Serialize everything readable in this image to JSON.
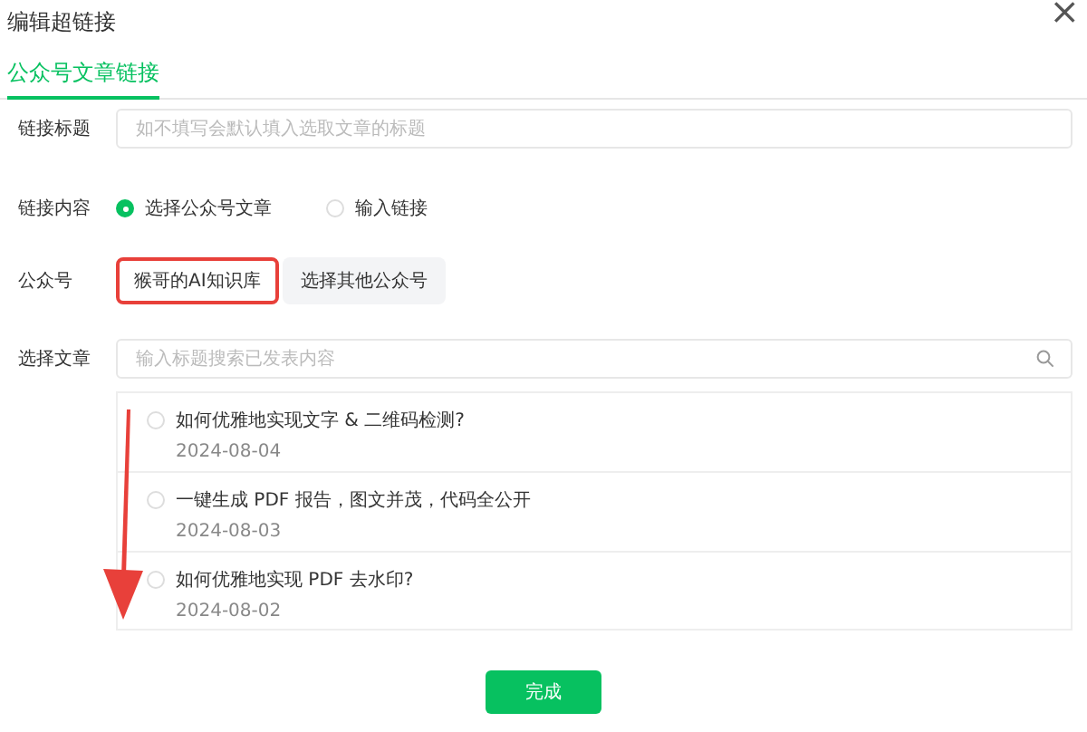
{
  "dialog": {
    "title": "编辑超链接",
    "close": "×"
  },
  "tabs": [
    {
      "label": "公众号文章链接",
      "selected": true
    }
  ],
  "link_title": {
    "label": "链接标题",
    "placeholder": "如不填写会默认填入选取文章的标题"
  },
  "link_content": {
    "label": "链接内容",
    "options": [
      {
        "label": "选择公众号文章",
        "selected": true
      },
      {
        "label": "输入链接",
        "selected": false
      }
    ]
  },
  "account": {
    "label": "公众号",
    "buttons": [
      {
        "label": "猴哥的AI知识库",
        "selected": true,
        "highlighted": true
      },
      {
        "label": "选择其他公众号",
        "selected": false,
        "highlighted": false
      }
    ]
  },
  "article": {
    "label": "选择文章",
    "placeholder": "输入标题搜索已发表内容",
    "items": [
      {
        "title": "如何优雅地实现文字 & 二维码检测?",
        "date": "2024-08-04",
        "selected": false
      },
      {
        "title": "一键生成 PDF 报告，图文并茂，代码全公开",
        "date": "2024-08-03",
        "selected": false
      },
      {
        "title": "如何优雅地实现 PDF 去水印?",
        "date": "2024-08-02",
        "selected": false
      }
    ]
  },
  "annotation_arrow": true,
  "done_button": "完成"
}
